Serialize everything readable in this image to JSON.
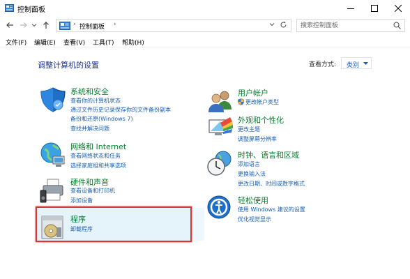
{
  "window": {
    "title": "控制面板",
    "brand_color": "#1a5fb4"
  },
  "address": {
    "crumb": "控制面板"
  },
  "search": {
    "placeholder": "搜索控制面板"
  },
  "menu": [
    "文件(F)",
    "编辑(E)",
    "查看(V)",
    "工具(T)",
    "帮助(H)"
  ],
  "main": {
    "heading": "调整计算机的设置",
    "view_by_label": "查看方式:",
    "view_by_value": "类别"
  },
  "categories": [
    {
      "title": "系统和安全",
      "links": [
        "查看你的计算机状态",
        "通过文件历史记录保存你的文件备份副本",
        "备份和还原(Windows 7)",
        "查找并解决问题"
      ]
    },
    {
      "title": "网络和 Internet",
      "links": [
        "查看网络状态和任务",
        "选择家庭组和共享选项"
      ]
    },
    {
      "title": "硬件和声音",
      "links": [
        "查看设备和打印机",
        "添加设备"
      ]
    },
    {
      "title": "程序",
      "links": [
        "卸载程序"
      ]
    },
    {
      "title": "用户帐户",
      "links": [
        "更改帐户类型"
      ]
    },
    {
      "title": "外观和个性化",
      "links": [
        "更改主题",
        "调整屏幕分辨率"
      ]
    },
    {
      "title": "时钟、语言和区域",
      "links": [
        "添加语言",
        "更换输入法",
        "更改日期、时间或数字格式"
      ]
    },
    {
      "title": "轻松使用",
      "links": [
        "使用 Windows 建议的设置",
        "优化视觉显示"
      ]
    }
  ],
  "colors": {
    "heading": "#1e3287",
    "category_title": "#0a7c2f",
    "link": "#1a5fb4",
    "highlight_border": "#d23a3a",
    "highlight_fill": "#e5f3fb"
  }
}
